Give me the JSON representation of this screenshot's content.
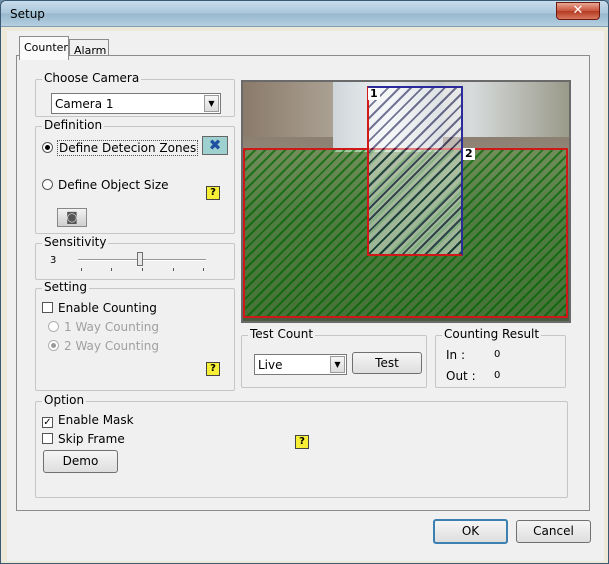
{
  "window": {
    "title": "Setup",
    "close_label": "✕"
  },
  "tabs": [
    {
      "label": "Counter"
    },
    {
      "label": "Alarm"
    }
  ],
  "choose_camera": {
    "legend": "Choose Camera",
    "selected": "Camera 1"
  },
  "definition": {
    "legend": "Definition",
    "option_zones": "Define Detecion Zones",
    "option_size": "Define Object Size"
  },
  "sensitivity": {
    "legend": "Sensitivity",
    "value": "3",
    "level": 3,
    "max": 5
  },
  "setting": {
    "legend": "Setting",
    "enable_counting": "Enable Counting",
    "one_way": "1 Way Counting",
    "two_way": "2 Way Counting"
  },
  "video": {
    "zone1_label": "1",
    "zone2_label": "2"
  },
  "test_count": {
    "legend": "Test Count",
    "mode": "Live",
    "test_button": "Test"
  },
  "counting_result": {
    "legend": "Counting Result",
    "in_label": "In :",
    "in_value": "0",
    "out_label": "Out :",
    "out_value": "0"
  },
  "option": {
    "legend": "Option",
    "enable_mask": "Enable Mask",
    "skip_frame": "Skip Frame",
    "demo_button": "Demo"
  },
  "footer": {
    "ok": "OK",
    "cancel": "Cancel"
  },
  "colors": {
    "zone_blue": "#2a2a9a",
    "zone_red": "#d01818",
    "help_yellow": "#f7ef36",
    "accent": "#3c7fb1"
  },
  "icons": {
    "help": "question-mark-icon",
    "zone_tool": "blue-cross-icon",
    "size_tool": "camera-icon"
  }
}
